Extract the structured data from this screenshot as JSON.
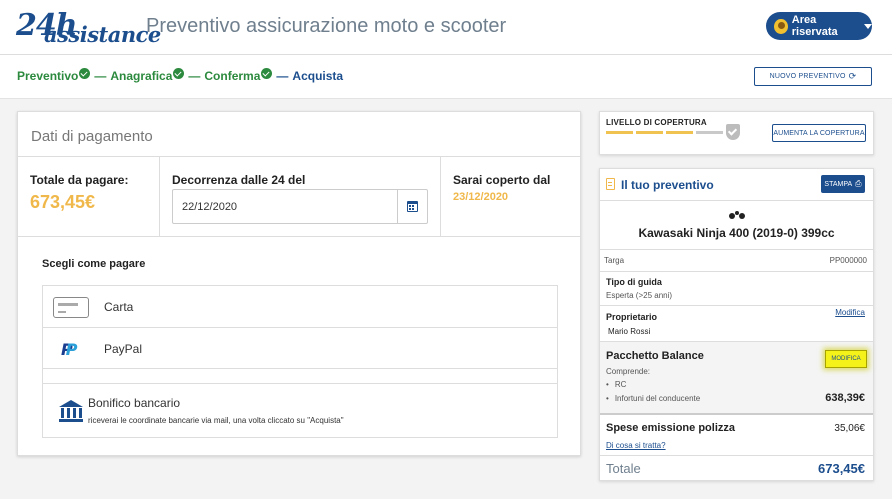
{
  "header": {
    "logo_num": "24h",
    "logo_word": "assistance",
    "title": "Preventivo assicurazione moto e scooter",
    "user_button": "Area riservata"
  },
  "steps": [
    {
      "label": "Preventivo",
      "done": true
    },
    {
      "label": "Anagrafica",
      "done": true
    },
    {
      "label": "Conferma",
      "done": true
    },
    {
      "label": "Acquista",
      "done": false
    }
  ],
  "new_quote_button": "NUOVO PREVENTIVO",
  "payment": {
    "title": "Dati di pagamento",
    "total_label": "Totale da pagare:",
    "total_value": "673,45€",
    "start_label": "Decorrenza dalle 24 del",
    "start_value": "22/12/2020",
    "covered_label": "Sarai coperto dal",
    "covered_value": "23/12/2020",
    "choose_label": "Scegli come pagare",
    "methods": {
      "card": "Carta",
      "paypal": "PayPal",
      "bank": "Bonifico bancario",
      "bank_note": "riceverai le coordinate bancarie via mail, una volta cliccato su \"Acquista\""
    }
  },
  "coverage": {
    "title": "LIVELLO DI COPERTURA",
    "level_filled": 3,
    "level_total": 4,
    "button": "AUMENTA LA COPERTURA"
  },
  "quote": {
    "title": "Il tuo preventivo",
    "print_button": "STAMPA",
    "vehicle": "Kawasaki Ninja 400 (2019-0) 399cc",
    "plate_label": "Targa",
    "plate_value": "PP000000",
    "drive_label": "Tipo di guida",
    "drive_value": "Esperta (>25 anni)",
    "owner_label": "Proprietario",
    "owner_value": "Mario Rossi",
    "owner_edit": "Modifica",
    "package_label": "Pacchetto Balance",
    "package_edit": "MODIFICA",
    "includes_label": "Comprende:",
    "includes": [
      "RC",
      "Infortuni del conducente"
    ],
    "package_price": "638,39€",
    "fees_label": "Spese emissione polizza",
    "fees_value": "35,06€",
    "fees_link": "Di cosa si tratta?",
    "total_label": "Totale",
    "total_value": "673,45€"
  }
}
